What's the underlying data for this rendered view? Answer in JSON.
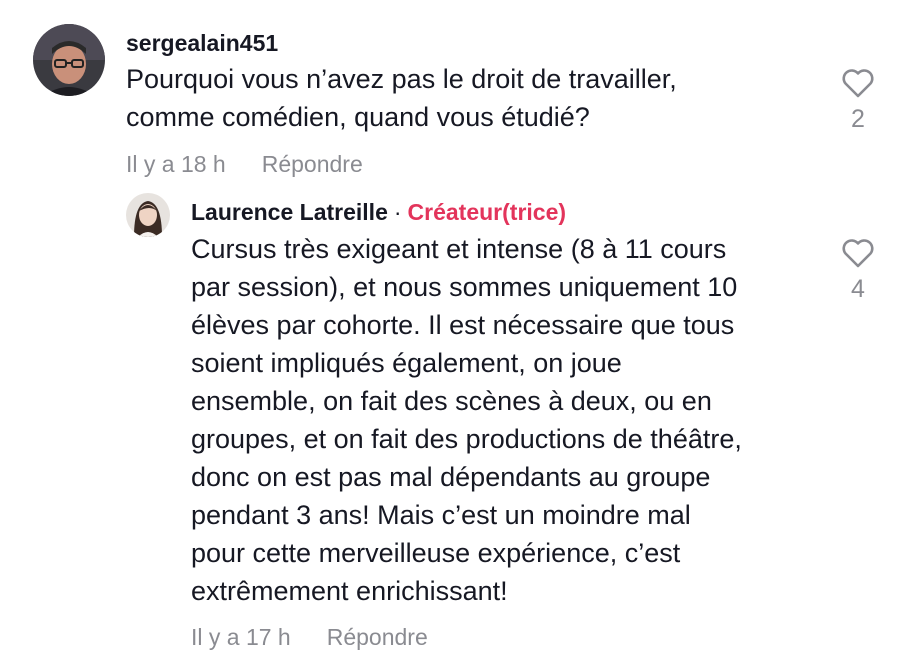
{
  "comment": {
    "username": "sergealain451",
    "text_lines": [
      "Pourquoi vous n’avez pas le droit de travailler,",
      "comme comédien, quand vous étudié?"
    ],
    "time": "Il y a 18 h",
    "reply_label": "Répondre",
    "likes": "2",
    "avatar_icon": "avatar-photo-man"
  },
  "reply": {
    "username": "Laurence Latreille",
    "separator": "·",
    "badge": "Créateur(trice)",
    "badge_color": "#e3345b",
    "text_lines": [
      "Cursus très exigeant et intense (8 à 11 cours",
      "par session), et nous sommes uniquement 10",
      "élèves par cohorte. Il est nécessaire que tous",
      "soient impliqués également, on joue",
      "ensemble, on fait des scènes à deux, ou en",
      "groupes, et on fait des productions de théâtre,",
      "donc on est pas mal dépendants au groupe",
      "pendant 3 ans! Mais c’est un moindre mal",
      "pour cette merveilleuse expérience, c’est",
      "extrêmement enrichissant!"
    ],
    "time": "Il y a 17 h",
    "reply_label": "Répondre",
    "likes": "4",
    "avatar_icon": "avatar-photo-woman"
  },
  "icons": {
    "like": "heart-outline-icon"
  }
}
